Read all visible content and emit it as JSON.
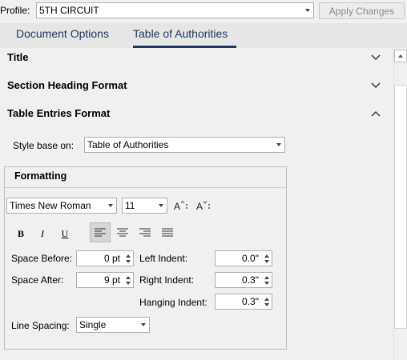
{
  "profile": {
    "label": "Profile:",
    "value": "5TH CIRCUIT"
  },
  "apply_button": "Apply Changes",
  "tabs": [
    {
      "label": "Document Options",
      "active": false
    },
    {
      "label": "Table of Authorities",
      "active": true
    }
  ],
  "sections": {
    "title": {
      "label": "Title",
      "expanded": false
    },
    "section_heading": {
      "label": "Section Heading Format",
      "expanded": false
    },
    "table_entries": {
      "label": "Table Entries Format",
      "expanded": true
    }
  },
  "style_base": {
    "label": "Style base on:",
    "value": "Table of Authorities"
  },
  "formatting": {
    "title": "Formatting",
    "font_family": "Times New Roman",
    "font_size": "11",
    "bold": "B",
    "italic": "I",
    "underline": "U",
    "alignment_selected": "left",
    "space_before": {
      "label": "Space Before:",
      "value": "0 pt"
    },
    "space_after": {
      "label": "Space After:",
      "value": "9 pt"
    },
    "left_indent": {
      "label": "Left Indent:",
      "value": "0.0\""
    },
    "right_indent": {
      "label": "Right Indent:",
      "value": "0.3\""
    },
    "hanging_indent": {
      "label": "Hanging Indent:",
      "value": "0.3\""
    },
    "line_spacing": {
      "label": "Line Spacing:",
      "value": "Single"
    }
  },
  "colors": {
    "accent": "#1e3a5f",
    "background": "#f0f0f0",
    "tab_bar": "#e6e6e6"
  }
}
